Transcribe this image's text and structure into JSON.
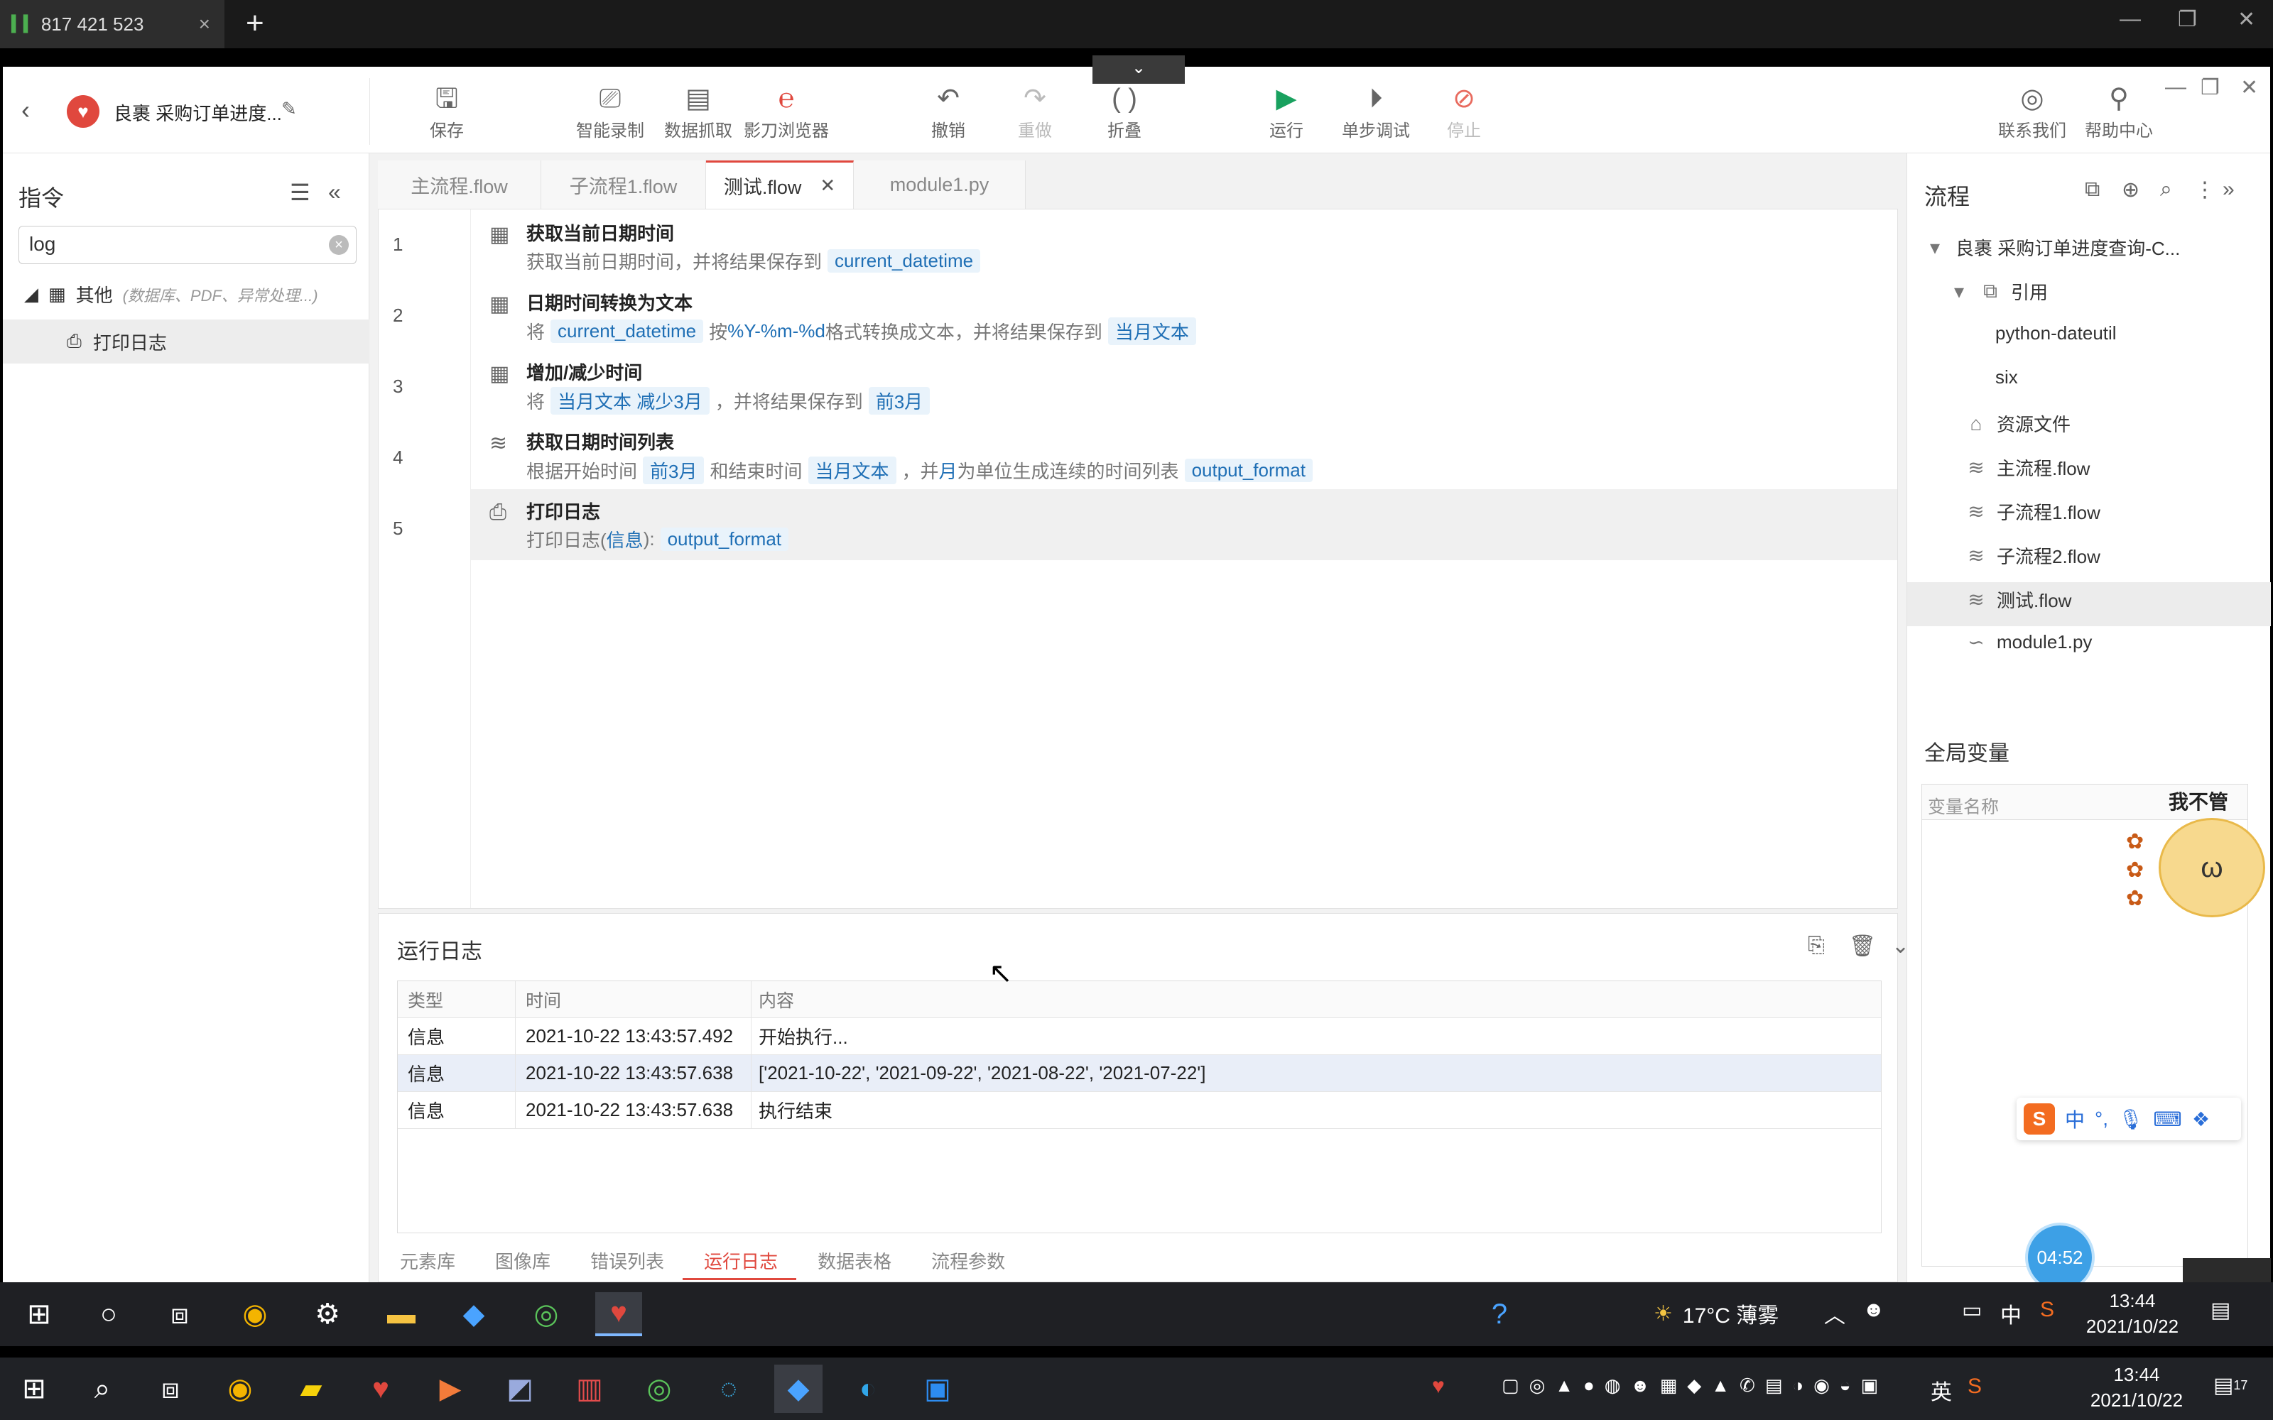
{
  "remote": {
    "tab_title": "817 421 523",
    "signal_icon": "signal-icon"
  },
  "toolbar": {
    "project_name": "良裹 采购订单进度...",
    "buttons": [
      {
        "label": "保存",
        "icon": "save-icon"
      },
      {
        "label": "智能录制",
        "icon": "record-icon"
      },
      {
        "label": "数据抓取",
        "icon": "data-capture-icon"
      },
      {
        "label": "影刀浏览器",
        "icon": "browser-icon"
      },
      {
        "label": "撤销",
        "icon": "undo-icon"
      },
      {
        "label": "重做",
        "icon": "redo-icon"
      },
      {
        "label": "折叠",
        "icon": "fold-icon"
      },
      {
        "label": "运行",
        "icon": "play-icon"
      },
      {
        "label": "单步调试",
        "icon": "step-debug-icon"
      },
      {
        "label": "停止",
        "icon": "stop-icon"
      },
      {
        "label": "联系我们",
        "icon": "contact-icon"
      },
      {
        "label": "帮助中心",
        "icon": "help-icon"
      }
    ]
  },
  "left_panel": {
    "title": "指令",
    "search_value": "log",
    "category": {
      "label": "其他",
      "hint": "(数据库、PDF、异常处理...)"
    },
    "leaf": "打印日志"
  },
  "tabs": [
    {
      "label": "主流程.flow"
    },
    {
      "label": "子流程1.flow"
    },
    {
      "label": "测试.flow"
    },
    {
      "label": "module1.py"
    }
  ],
  "steps": [
    {
      "num": "1",
      "title": "获取当前日期时间",
      "desc": [
        {
          "t": "获取当前日期时间，并将结果保存到"
        },
        {
          "chip": "current_datetime"
        }
      ]
    },
    {
      "num": "2",
      "title": "日期时间转换为文本",
      "desc": [
        {
          "t": "将"
        },
        {
          "chip": "current_datetime"
        },
        {
          "t": "按"
        },
        {
          "kw": "%Y-%m-%d"
        },
        {
          "t": "格式转换成文本，并将结果保存到"
        },
        {
          "chip": "当月文本"
        }
      ]
    },
    {
      "num": "3",
      "title": "增加/减少时间",
      "desc": [
        {
          "t": "将"
        },
        {
          "chip": "当月文本 减少3月"
        },
        {
          "t": "，并将结果保存到"
        },
        {
          "chip": "前3月"
        }
      ]
    },
    {
      "num": "4",
      "title": "获取日期时间列表",
      "desc": [
        {
          "t": "根据开始时间"
        },
        {
          "chip": "前3月"
        },
        {
          "t": "和结束时间"
        },
        {
          "chip": "当月文本"
        },
        {
          "t": "，并"
        },
        {
          "kw": "月"
        },
        {
          "t": "为单位生成连续的时间列表"
        },
        {
          "chip": "output_format"
        }
      ]
    },
    {
      "num": "5",
      "title": "打印日志",
      "desc": [
        {
          "t": "打印日志("
        },
        {
          "kw": "信息"
        },
        {
          "t": "):"
        },
        {
          "chip": "output_format"
        }
      ]
    }
  ],
  "log": {
    "title": "运行日志",
    "headers": [
      "类型",
      "时间",
      "内容"
    ],
    "rows": [
      {
        "type": "信息",
        "time": "2021-10-22 13:43:57.492",
        "content": "开始执行..."
      },
      {
        "type": "信息",
        "time": "2021-10-22 13:43:57.638",
        "content": "['2021-10-22', '2021-09-22', '2021-08-22', '2021-07-22']"
      },
      {
        "type": "信息",
        "time": "2021-10-22 13:43:57.638",
        "content": "执行结束"
      }
    ],
    "bottom_tabs": [
      "元素库",
      "图像库",
      "错误列表",
      "运行日志",
      "数据表格",
      "流程参数"
    ]
  },
  "right_panel": {
    "title": "流程",
    "root": "良裹 采购订单进度查询-C...",
    "ref": "引用",
    "libs": [
      "python-dateutil",
      "six"
    ],
    "resources": "资源文件",
    "files": [
      "主流程.flow",
      "子流程1.flow",
      "子流程2.flow",
      "测试.flow",
      "module1.py"
    ],
    "global_vars_title": "全局变量",
    "var_name_header": "变量名称",
    "sticker_text": "我不管",
    "timer": "04:52"
  },
  "ime": {
    "lang": "中"
  },
  "taskbar1": {
    "weather": "17°C 薄雾",
    "ime": "中",
    "time": "13:44",
    "date": "2021/10/22"
  },
  "taskbar2": {
    "ime": "英",
    "time": "13:44",
    "date": "2021/10/22",
    "notif": "17"
  }
}
